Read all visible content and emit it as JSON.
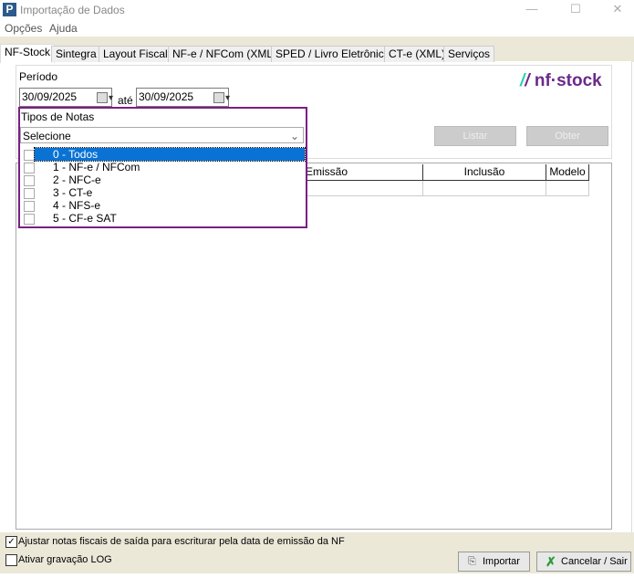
{
  "window": {
    "title": "Importação de Dados",
    "minimize": "—",
    "maximize": "☐",
    "close": "✕"
  },
  "menu": [
    "Opções",
    "Ajuda"
  ],
  "tabs": [
    "NF-Stock",
    "Sintegra",
    "Layout Fiscal",
    "NF-e / NFCom (XML)",
    "SPED / Livro Eletrônico",
    "CT-e (XML)",
    "Serviços"
  ],
  "periodo": {
    "label": "Período",
    "from": "30/09/2025",
    "to_label": "até",
    "to": "30/09/2025"
  },
  "logo": "nf·stock",
  "tipos": {
    "label": "Tipos de Notas",
    "value": "Selecione",
    "options": [
      "0 - Todos",
      "1 - NF-e / NFCom",
      "2 - NFC-e",
      "3 - CT-e",
      "4 - NFS-e",
      "5 - CF-e SAT"
    ]
  },
  "buttons": {
    "listar": "Listar",
    "obter": "Obter",
    "importar": "Importar",
    "cancelar": "Cancelar / Sair"
  },
  "grid": {
    "columns": [
      "Emissão",
      "Inclusão",
      "Modelo"
    ]
  },
  "options": {
    "ajustar": "Ajustar notas fiscais de saída para escriturar pela data de emissão da NF",
    "ajustar_checked": true,
    "log": "Ativar gravação LOG",
    "log_checked": false
  },
  "colors": {
    "accent": "#7b1e84",
    "selection": "#0a72d4"
  }
}
